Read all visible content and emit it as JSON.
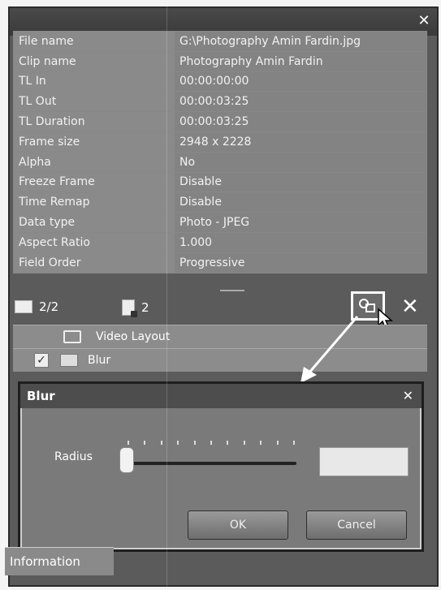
{
  "window": {
    "close_glyph": "✕"
  },
  "properties": [
    {
      "key": "File name",
      "value": "G:\\Photography Amin Fardin.jpg"
    },
    {
      "key": "Clip name",
      "value": "Photography Amin Fardin"
    },
    {
      "key": "TL In",
      "value": "00:00:00:00"
    },
    {
      "key": "TL Out",
      "value": "00:00:03:25"
    },
    {
      "key": "TL Duration",
      "value": "00:00:03:25"
    },
    {
      "key": "Frame size",
      "value": "2948 x 2228"
    },
    {
      "key": "Alpha",
      "value": "No"
    },
    {
      "key": "Freeze Frame",
      "value": "Disable"
    },
    {
      "key": "Time Remap",
      "value": "Disable"
    },
    {
      "key": "Data type",
      "value": "Photo - JPEG"
    },
    {
      "key": "Aspect Ratio",
      "value": "1.000"
    },
    {
      "key": "Field Order",
      "value": "Progressive"
    }
  ],
  "toolbar": {
    "page_count": "2/2",
    "layer_count": "2",
    "close_glyph": "✕"
  },
  "effects": {
    "video_layout_label": "Video Layout",
    "blur_label": "Blur"
  },
  "dialog": {
    "title": "Blur",
    "close_glyph": "✕",
    "radius_label": "Radius",
    "radius_value": "",
    "ok_label": "OK",
    "cancel_label": "Cancel"
  },
  "bottom_tab": {
    "label": "Information"
  }
}
